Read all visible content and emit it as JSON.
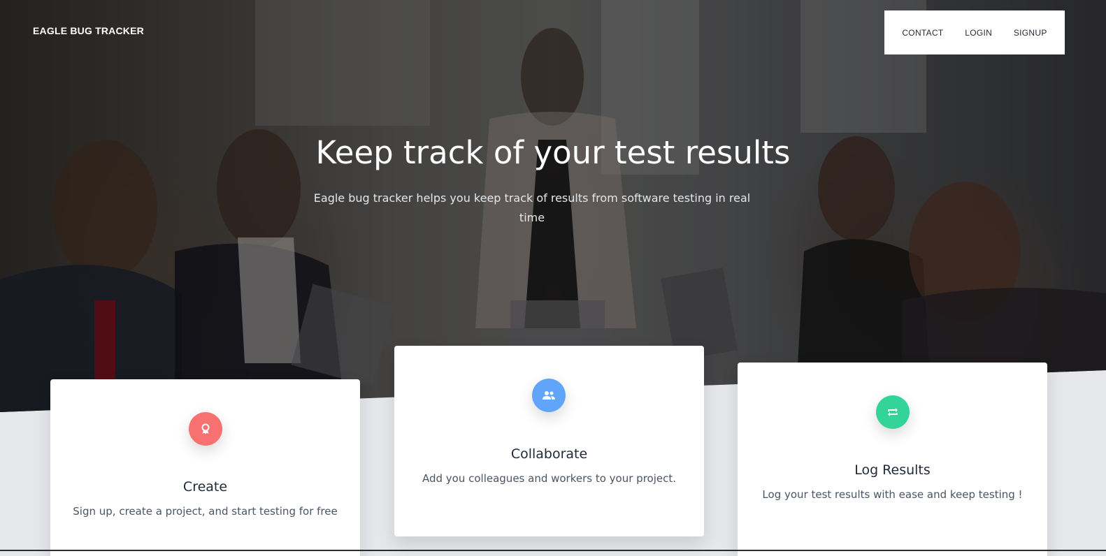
{
  "nav": {
    "brand": "EAGLE BUG TRACKER",
    "links": [
      "CONTACT",
      "LOGIN",
      "SIGNUP"
    ]
  },
  "hero": {
    "title": "Keep track of your test results",
    "subtitle": "Eagle bug tracker helps you keep track of results from software testing in real time"
  },
  "cards": [
    {
      "title": "Create",
      "text": "Sign up, create a project, and start testing for free",
      "icon": "award-icon",
      "color": "#f87171"
    },
    {
      "title": "Collaborate",
      "text": "Add you colleagues and workers to your project.",
      "icon": "users-icon",
      "color": "#60a5fa"
    },
    {
      "title": "Log Results",
      "text": "Log your test results with ease and keep testing !",
      "icon": "retweet-icon",
      "color": "#34d399"
    }
  ],
  "colors": {
    "card_create": "#f87171",
    "card_collaborate": "#60a5fa",
    "card_log": "#34d399",
    "page_bg": "#e5e7eb"
  }
}
